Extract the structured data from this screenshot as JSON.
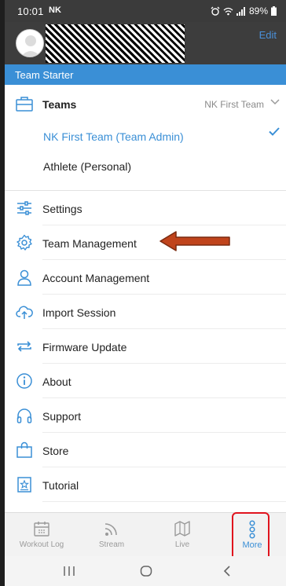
{
  "status_bar": {
    "time": "10:01",
    "carrier": "NK",
    "battery": "89%"
  },
  "header": {
    "edit_label": "Edit"
  },
  "plan": {
    "label": "Team Starter"
  },
  "teams": {
    "label": "Teams",
    "selected": "NK First Team",
    "options": [
      "NK First Team (Team Admin)",
      "Athlete (Personal)"
    ]
  },
  "menu": {
    "items": [
      {
        "label": "Settings",
        "icon": "sliders-icon"
      },
      {
        "label": "Team Management",
        "icon": "gear-icon"
      },
      {
        "label": "Account Management",
        "icon": "user-icon"
      },
      {
        "label": "Import Session",
        "icon": "cloud-upload-icon"
      },
      {
        "label": "Firmware Update",
        "icon": "refresh-icon"
      },
      {
        "label": "About",
        "icon": "info-icon"
      },
      {
        "label": "Support",
        "icon": "headphones-icon"
      },
      {
        "label": "Store",
        "icon": "shopping-bag-icon"
      },
      {
        "label": "Tutorial",
        "icon": "tutorial-icon"
      }
    ]
  },
  "tabs": [
    {
      "label": "Workout Log",
      "icon": "calendar-icon"
    },
    {
      "label": "Stream",
      "icon": "stream-icon"
    },
    {
      "label": "Live",
      "icon": "map-icon"
    },
    {
      "label": "More",
      "icon": "more-dots-icon"
    }
  ],
  "colors": {
    "accent": "#3a8fd6",
    "highlight": "#e0141e",
    "arrow": "#c0441c"
  }
}
